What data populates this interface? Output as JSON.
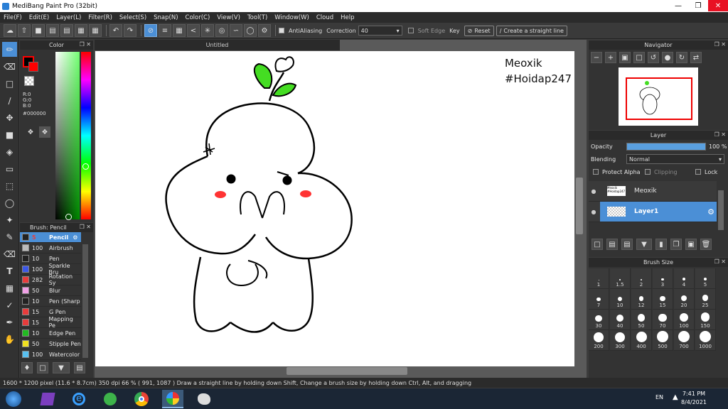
{
  "window": {
    "title": "MediBang Paint Pro (32bit)"
  },
  "menu": [
    "File(F)",
    "Edit(E)",
    "Layer(L)",
    "Filter(R)",
    "Select(S)",
    "Snap(N)",
    "Color(C)",
    "View(V)",
    "Tool(T)",
    "Window(W)",
    "Cloud",
    "Help"
  ],
  "toolbar": {
    "antialiasing_label": "AntiAliasing",
    "correction_label": "Correction",
    "correction_value": "40",
    "soft_edge_label": "Soft Edge",
    "key_label": "Key",
    "reset_label": "Reset",
    "straight_line_label": "Create a straight line"
  },
  "color_panel": {
    "title": "Color",
    "r": "R:0",
    "g": "G:0",
    "b": "B:0",
    "hex": "#000000",
    "primary": "#000000",
    "secondary": "#ff0000"
  },
  "brush_panel": {
    "title": "Brush: Pencil",
    "items": [
      {
        "size": "5",
        "name": "Pencil",
        "color": "#222222"
      },
      {
        "size": "100",
        "name": "Airbrush",
        "color": "#bbbbbb"
      },
      {
        "size": "10",
        "name": "Pen",
        "color": "#222222"
      },
      {
        "size": "100",
        "name": "Sparkle Bru",
        "color": "#3c58e8"
      },
      {
        "size": "282",
        "name": "Rotation Sy",
        "color": "#e83c3c"
      },
      {
        "size": "50",
        "name": "Blur",
        "color": "#f0a0e6"
      },
      {
        "size": "10",
        "name": "Pen (Sharp",
        "color": "#222222"
      },
      {
        "size": "15",
        "name": "G Pen",
        "color": "#e83c3c"
      },
      {
        "size": "15",
        "name": "Mapping Pe",
        "color": "#e83c3c"
      },
      {
        "size": "10",
        "name": "Edge Pen",
        "color": "#22bb22"
      },
      {
        "size": "50",
        "name": "Stipple Pen",
        "color": "#f0e020"
      },
      {
        "size": "100",
        "name": "Watercolor",
        "color": "#58c0f0"
      }
    ]
  },
  "document": {
    "tab_title": "Untitled",
    "text_line1": "Meoxik",
    "text_line2": "#Hoidap247"
  },
  "navigator": {
    "title": "Navigator"
  },
  "layer_panel": {
    "title": "Layer",
    "opacity_label": "Opacity",
    "opacity_value": "100 %",
    "opacity_fraction": 1.0,
    "blending_label": "Blending",
    "blending_value": "Normal",
    "protect_alpha": "Protect Alpha",
    "clipping": "Clipping",
    "lock": "Lock",
    "layers": [
      {
        "name": "Meoxik",
        "thumb_text": "Meoxik #Hoidap247",
        "selected": false
      },
      {
        "name": "Layer1",
        "selected": true
      }
    ]
  },
  "brush_size": {
    "title": "Brush Size",
    "sizes": [
      "1",
      "1.5",
      "2",
      "3",
      "4",
      "5",
      "7",
      "10",
      "12",
      "15",
      "20",
      "25",
      "30",
      "40",
      "50",
      "70",
      "100",
      "150",
      "200",
      "300",
      "400",
      "500",
      "700",
      "1000"
    ]
  },
  "status": {
    "text": "1600 * 1200 pixel   (11.6 * 8.7cm)   350 dpi   66 %   ( 991, 1087 )   Draw a straight line by holding down Shift, Change a brush size by holding down Ctrl, Alt, and dragging"
  },
  "taskbar": {
    "lang": "EN",
    "time": "7:41 PM",
    "date": "8/4/2021"
  }
}
